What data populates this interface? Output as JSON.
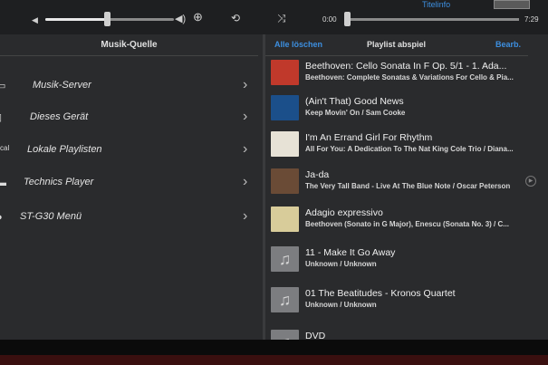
{
  "transport": {
    "time_current": "0:00",
    "time_total": "7:29",
    "titelinfo": "Titelinfo",
    "volume_level": 0.5,
    "progress_level": 0.0,
    "icons": [
      "volume-low-icon",
      "volume-high-icon",
      "plus-icon",
      "repeat-icon",
      "shuffle-icon"
    ]
  },
  "left": {
    "title": "Musik-Quelle",
    "items": [
      {
        "label": "Musik-Server",
        "icon": "server-icon"
      },
      {
        "label": "Dieses Gerät",
        "icon": "tablet-icon"
      },
      {
        "label": "Lokale Playlisten",
        "icon": "local-playlist-icon",
        "icon_text": "cal"
      },
      {
        "label": "Technics Player",
        "icon": "player-icon"
      },
      {
        "label": "ST-G30 Menü",
        "icon": "menu-icon"
      }
    ]
  },
  "right": {
    "clear_label": "Alle löschen",
    "title": "Playlist abspiel",
    "edit_label": "Bearb.",
    "items": [
      {
        "title": "Beethoven: Cello Sonata In F Op. 5/1 - 1. Ada...",
        "subtitle": "Beethoven: Complete Sonatas & Variations For Cello & Pia..."
      },
      {
        "title": "(Ain't That) Good News",
        "subtitle": "Keep Movin' On / Sam Cooke"
      },
      {
        "title": "I'm An Errand Girl For Rhythm",
        "subtitle": "All For You: A Dedication To The Nat King Cole Trio / Diana..."
      },
      {
        "title": "Ja-da",
        "subtitle": "The Very Tall Band - Live At The Blue Note / Oscar Peterson"
      },
      {
        "title": "Adagio expressivo",
        "subtitle": "Beethoven (Sonato in G Major), Enescu (Sonata No. 3) / C..."
      },
      {
        "title": "11 - Make It Go Away",
        "subtitle": "Unknown / Unknown"
      },
      {
        "title": "01 The Beatitudes - Kronos Quartet",
        "subtitle": "Unknown / Unknown"
      },
      {
        "title": "DVD",
        "subtitle": ""
      }
    ]
  },
  "colors": {
    "accent": "#3d8fe0",
    "panel": "#2a2b2d",
    "cover1": "#c0392b",
    "cover2": "#1b4f8a",
    "cover3": "#e7e2d6",
    "cover4": "#6a4b36",
    "cover5": "#d8cc9a"
  }
}
